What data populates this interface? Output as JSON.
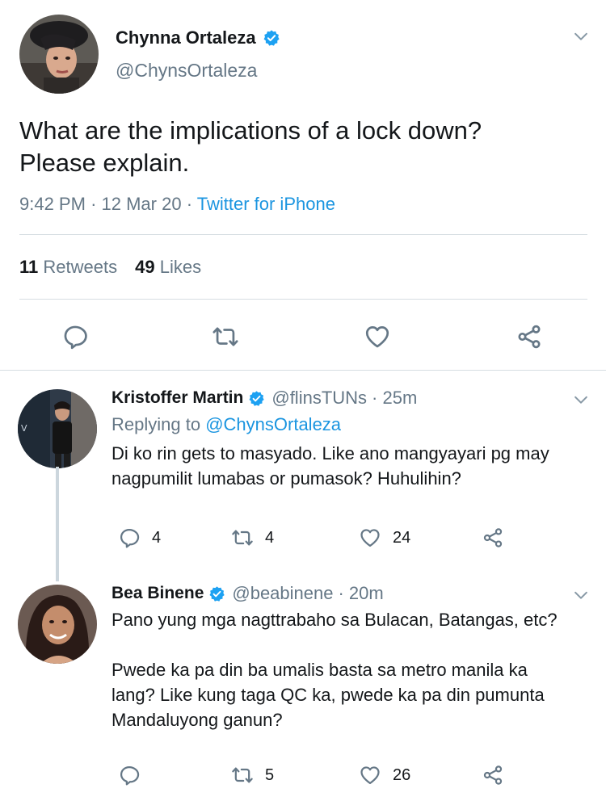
{
  "main_tweet": {
    "author_name": "Chynna Ortaleza",
    "author_handle": "@ChynsOrtaleza",
    "text_line1": "What are the implications of a lock down?",
    "text_line2": "Please explain.",
    "time": "9:42 PM",
    "date": "12 Mar 20",
    "source": "Twitter for iPhone",
    "separator": "·",
    "retweets_count": "11",
    "retweets_label": "Retweets",
    "likes_count": "49",
    "likes_label": "Likes"
  },
  "replies": [
    {
      "author_name": "Kristoffer Martin",
      "author_handle": "@flinsTUNs",
      "age": "· 25m",
      "replying_label": "Replying to",
      "replying_handle": "@ChynsOrtaleza",
      "text_line1": "Di ko rin gets to masyado. Like ano mangyayari pg may",
      "text_line2": "nagpumilit lumabas or pumasok? Huhulihin?",
      "retweets": "4",
      "likes": "24",
      "replies": "4"
    },
    {
      "author_name": "Bea Binene",
      "author_handle": "@beabinene",
      "age": "· 20m",
      "text_line1": "Pano yung mga nagttrabaho sa Bulacan, Batangas, etc?",
      "text_line2": "Pwede ka pa din ba umalis basta sa metro manila ka",
      "text_line3": "lang? Like kung taga QC ka, pwede ka pa din pumunta",
      "text_line4": "Mandaluyong ganun?",
      "retweets": "5",
      "likes": "26"
    }
  ],
  "icons": {
    "reply": "reply-icon",
    "retweet": "retweet-icon",
    "like": "heart-icon",
    "share": "share-icon",
    "verified": "verified-badge-icon",
    "more": "chevron-down-icon"
  },
  "colors": {
    "link": "#1b95e0",
    "muted": "#657786",
    "icon": "#657786",
    "verified": "#1da1f2",
    "divider": "#d6dde2"
  }
}
